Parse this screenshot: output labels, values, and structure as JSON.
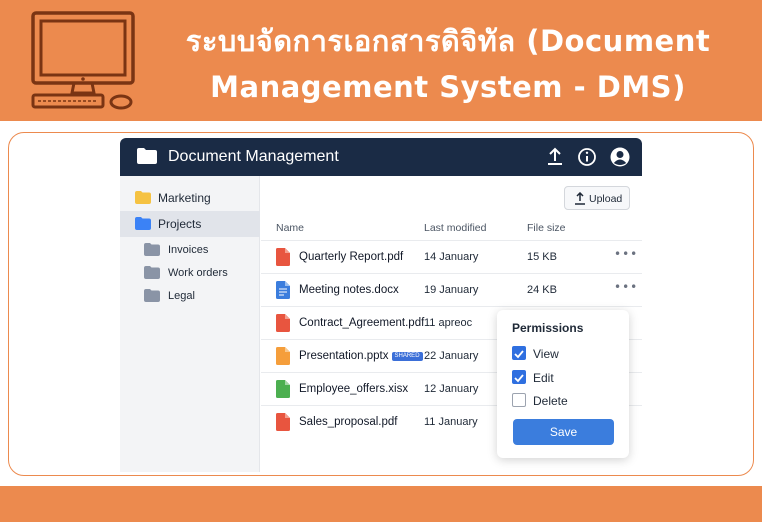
{
  "banner": {
    "title": "ระบบจัดการเอกสารดิจิทัล (Document Management System - DMS)",
    "icon": "computer-monitor-icon",
    "color": "#ec8a4e"
  },
  "app": {
    "title": "Document Management",
    "header_icons": [
      "upload-icon",
      "info-icon",
      "user-account-icon"
    ]
  },
  "sidebar": {
    "items": [
      {
        "label": "Marketing",
        "icon": "folder-icon",
        "color": "#f5c242"
      },
      {
        "label": "Projects",
        "icon": "folder-icon",
        "color": "#3b82f6",
        "active": true
      },
      {
        "label": "Invoices",
        "icon": "folder-icon",
        "color": "#8a94a6"
      },
      {
        "label": "Work orders",
        "icon": "folder-icon",
        "color": "#8a94a6"
      },
      {
        "label": "Legal",
        "icon": "folder-icon",
        "color": "#8a94a6"
      }
    ]
  },
  "toolbar": {
    "upload_label": "Upload"
  },
  "table": {
    "columns": [
      "Name",
      "Last modified",
      "File size"
    ],
    "rows": [
      {
        "name": "Quarterly Report.pdf",
        "modified": "14 January",
        "size": "15 KB",
        "type": "pdf",
        "color": "#e8553f"
      },
      {
        "name": "Meeting notes.docx",
        "modified": "19 January",
        "size": "24 KB",
        "type": "docx",
        "color": "#3b7ddd"
      },
      {
        "name": "Contract_Agreement.pdf",
        "modified": "11 apreoc",
        "size": "",
        "type": "pdf",
        "color": "#e8553f"
      },
      {
        "name": "Presentation.pptx",
        "badge": "SHARED",
        "modified": "22 January",
        "size": "",
        "type": "pptx",
        "color": "#f59e3b"
      },
      {
        "name": "Employee_offers.xisx",
        "modified": "12 January",
        "size": "",
        "type": "xlsx",
        "color": "#4caf50"
      },
      {
        "name": "Sales_proposal.pdf",
        "modified": "11 January",
        "size": "",
        "type": "pdf",
        "color": "#e8553f"
      }
    ]
  },
  "permissions": {
    "title": "Permissions",
    "options": [
      {
        "label": "View",
        "checked": true
      },
      {
        "label": "Edit",
        "checked": true
      },
      {
        "label": "Delete",
        "checked": false
      }
    ],
    "save_label": "Save"
  }
}
